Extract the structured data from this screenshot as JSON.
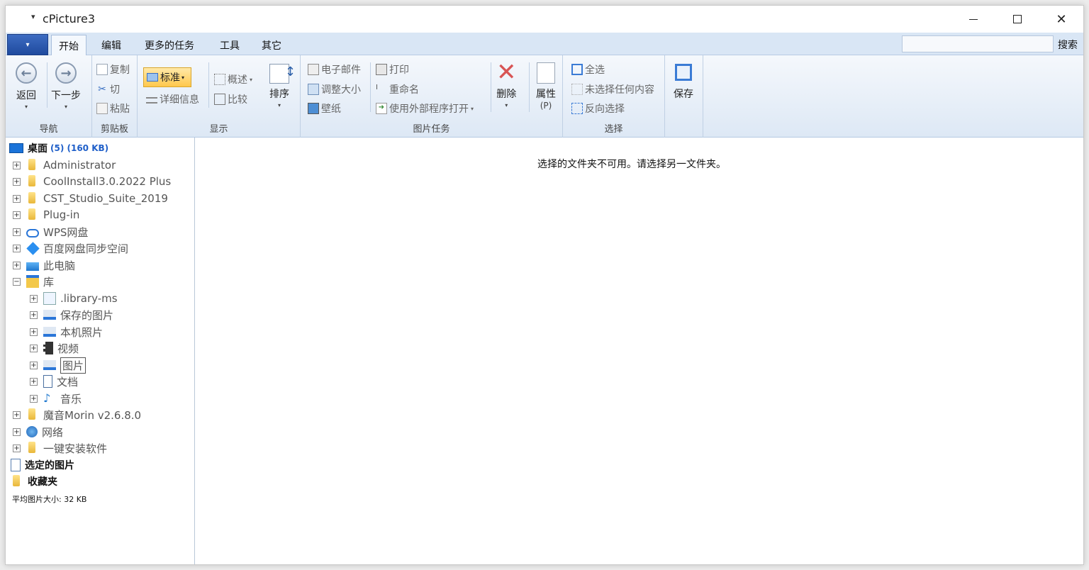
{
  "window": {
    "quick_access": "▾",
    "title": "cPicture3",
    "minimize_symbol": "",
    "close_symbol": "✕"
  },
  "tabs": {
    "app_menu_caret": "▾",
    "items": [
      "开始",
      "编辑",
      "更多的任务",
      "工具",
      "其它"
    ],
    "active_index": 0,
    "search_label": "搜索",
    "search_value": ""
  },
  "ribbon": {
    "nav": {
      "back": "返回",
      "next": "下一步",
      "group_label": "导航"
    },
    "clipboard": {
      "copy": "复制",
      "cut": "切",
      "paste": "粘贴",
      "group_label": "剪贴板"
    },
    "display": {
      "standard": "标准",
      "overview": "概述",
      "details": "详细信息",
      "compare": "比较",
      "sort": "排序",
      "group_label": "显示"
    },
    "picture_tasks": {
      "email": "电子邮件",
      "resize": "调整大小",
      "wallpaper": "壁纸",
      "print": "打印",
      "rename": "重命名",
      "open_external": "使用外部程序打开",
      "delete": "删除",
      "properties": "属性",
      "properties_key": "(P)",
      "group_label": "图片任务"
    },
    "selection": {
      "select_all": "全选",
      "select_none": "未选择任何内容",
      "invert": "反向选择",
      "group_label": "选择"
    },
    "save": {
      "label": "保存"
    }
  },
  "tree": {
    "root": {
      "label": "桌面",
      "count": "(5) (160 KB)"
    },
    "items": [
      {
        "label": "Administrator",
        "icon": "user-folder-icon"
      },
      {
        "label": "CoolInstall3.0.2022 Plus",
        "icon": "folder-icon"
      },
      {
        "label": "CST_Studio_Suite_2019",
        "icon": "folder-icon"
      },
      {
        "label": "Plug-in",
        "icon": "folder-icon"
      },
      {
        "label": "WPS网盘",
        "icon": "cloud-icon"
      },
      {
        "label": "百度网盘同步空间",
        "icon": "baidu-sync-icon"
      },
      {
        "label": "此电脑",
        "icon": "computer-icon"
      },
      {
        "label": "库",
        "icon": "library-icon"
      }
    ],
    "library_children": [
      {
        "label": ".library-ms",
        "icon": "library-file-icon"
      },
      {
        "label": "保存的图片",
        "icon": "pictures-icon"
      },
      {
        "label": "本机照片",
        "icon": "pictures-icon"
      },
      {
        "label": "视频",
        "icon": "video-icon"
      },
      {
        "label": "图片",
        "icon": "pictures-icon"
      },
      {
        "label": "文档",
        "icon": "documents-icon"
      },
      {
        "label": "音乐",
        "icon": "music-icon"
      }
    ],
    "after_items": [
      {
        "label": "魔音Morin v2.6.8.0",
        "icon": "folder-icon"
      },
      {
        "label": "网络",
        "icon": "network-icon"
      },
      {
        "label": "一键安装软件",
        "icon": "folder-icon"
      }
    ],
    "selected_pictures": "选定的图片",
    "favorites": "收藏夹",
    "average_size": "平均图片大小: 32 KB"
  },
  "main": {
    "message": "选择的文件夹不可用。请选择另一文件夹。"
  }
}
